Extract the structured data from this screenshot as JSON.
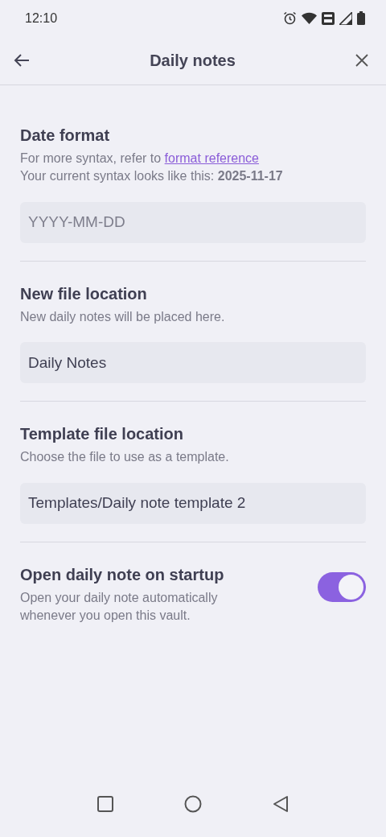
{
  "status_bar": {
    "time": "12:10"
  },
  "header": {
    "title": "Daily notes"
  },
  "settings": [
    {
      "kind": "text-field",
      "title": "Date format",
      "link_line": {
        "text": "For more syntax, refer to ",
        "link": "format reference"
      },
      "description": "Your current syntax looks like this: **2025-11-17**",
      "placeholder": "YYYY-MM-DD"
    },
    {
      "kind": "text-field",
      "title": "New file location",
      "description": "New daily notes will be placed here.",
      "value": "Daily Notes"
    },
    {
      "kind": "text-field",
      "title": "Template file location",
      "description": "Choose the file to use as a template.",
      "value": "Templates/Daily note template 2"
    },
    {
      "kind": "toggle",
      "title": "Open daily note on startup",
      "description": "Open your daily note automatically whenever you open this vault.",
      "on": true
    }
  ]
}
